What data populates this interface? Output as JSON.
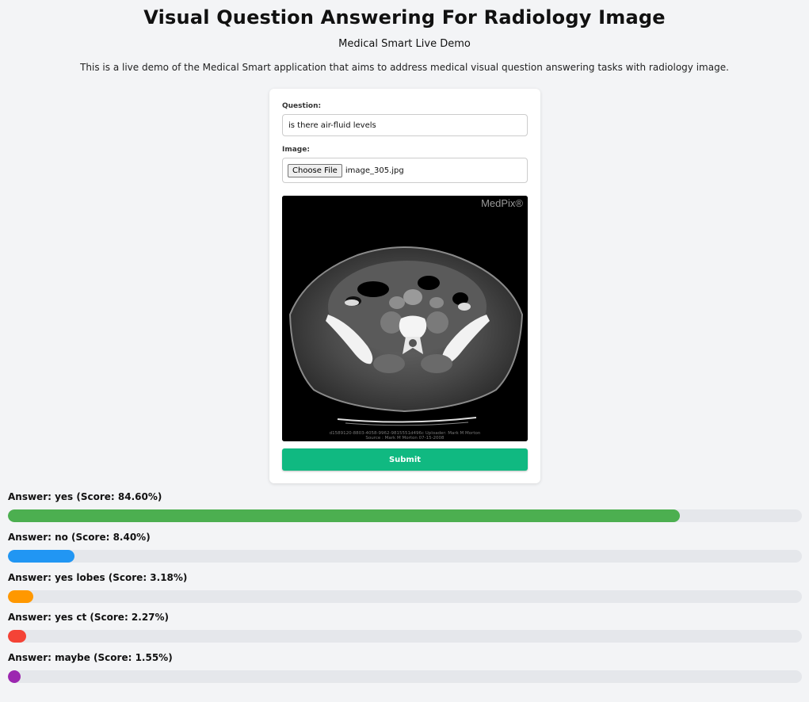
{
  "header": {
    "title": "Visual Question Answering For Radiology Image",
    "subtitle": "Medical Smart Live Demo",
    "description": "This is a live demo of the Medical Smart application that aims to address medical visual question answering tasks with radiology image."
  },
  "form": {
    "question_label": "Question:",
    "question_value": "is there air-fluid levels",
    "image_label": "Image:",
    "choose_file_label": "Choose File",
    "file_name": "image_305.jpg",
    "image_watermark": "MedPix®",
    "image_caption_line1": "d1589120-8803-4058-9962-9815551d496c Uploader: Mark M Morton",
    "image_caption_line2": "Source : Mark M Morton 07-15-2008",
    "submit_label": "Submit",
    "submit_color": "#10b981"
  },
  "results": [
    {
      "label": "Answer: yes (Score: 84.60%)",
      "score": 84.6,
      "color": "#4caf50"
    },
    {
      "label": "Answer: no (Score: 8.40%)",
      "score": 8.4,
      "color": "#2196f3"
    },
    {
      "label": "Answer: yes lobes (Score: 3.18%)",
      "score": 3.18,
      "color": "#ff9800"
    },
    {
      "label": "Answer: yes ct (Score: 2.27%)",
      "score": 2.27,
      "color": "#f44336"
    },
    {
      "label": "Answer: maybe (Score: 1.55%)",
      "score": 1.55,
      "color": "#9c27b0"
    }
  ]
}
